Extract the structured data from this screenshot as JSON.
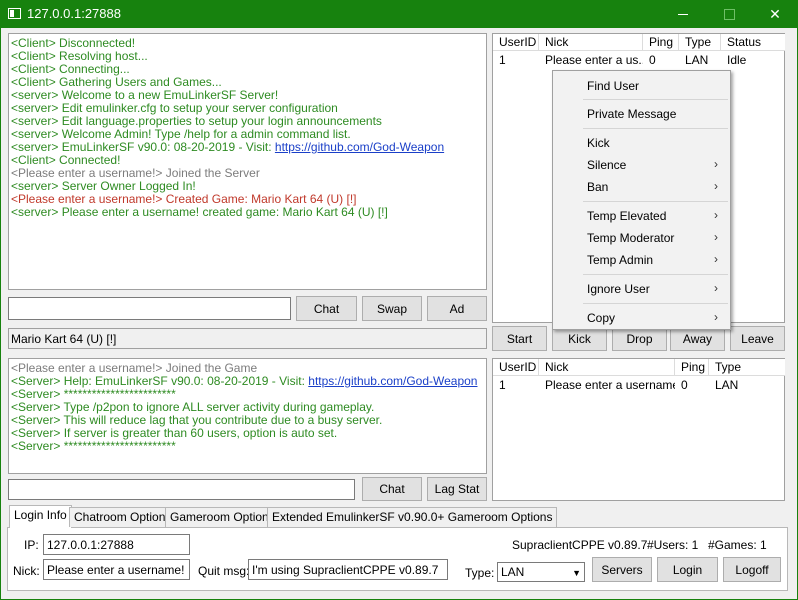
{
  "window": {
    "title": "127.0.0.1:27888",
    "close_glyph": "✕"
  },
  "server_chat": {
    "lines": [
      {
        "text": "<Client> Disconnected!",
        "cls": "g"
      },
      {
        "text": "<Client> Resolving host...",
        "cls": "g"
      },
      {
        "text": "<Client> Connecting...",
        "cls": "g"
      },
      {
        "text": "<Client> Gathering Users and Games...",
        "cls": "g"
      },
      {
        "text": "<server> Welcome to a new EmuLinkerSF Server!",
        "cls": "g"
      },
      {
        "text": "<server> Edit emulinker.cfg to setup your server configuration",
        "cls": "g"
      },
      {
        "text": "<server> Edit language.properties to setup your login announcements",
        "cls": "g"
      },
      {
        "text": "<server> Welcome Admin! Type /help for a admin command list.",
        "cls": "g"
      },
      {
        "text": "<server> EmuLinkerSF v90.0: 08-20-2019 - Visit: ",
        "cls": "g",
        "link": "https://github.com/God-Weapon"
      },
      {
        "text": "<Client> Connected!",
        "cls": "g"
      },
      {
        "text": "<Please enter a username!> Joined the Server",
        "cls": "gray"
      },
      {
        "text": "<server> Server Owner Logged In!",
        "cls": "g"
      },
      {
        "text": "<Please enter a username!> Created Game: Mario Kart 64 (U) [!]",
        "cls": "red"
      },
      {
        "text": "<server> Please enter a username! created game: Mario Kart 64 (U) [!]",
        "cls": "g"
      }
    ],
    "input_value": "",
    "chat_button": "Chat",
    "swap_button": "Swap",
    "ad_button": "Ad"
  },
  "users_table": {
    "headers": [
      "UserID",
      "Nick",
      "Ping",
      "Type",
      "Status"
    ],
    "rows": [
      [
        "1",
        "Please enter a us...",
        "0",
        "LAN",
        "Idle"
      ]
    ]
  },
  "context_menu": {
    "items": [
      {
        "label": "Find User",
        "submenu": false
      },
      {
        "label": "Private Message",
        "submenu": false
      },
      {
        "label": "Kick",
        "submenu": false
      },
      {
        "label": "Silence",
        "submenu": true
      },
      {
        "label": "Ban",
        "submenu": true
      },
      {
        "label": "Temp Elevated",
        "submenu": true
      },
      {
        "label": "Temp Moderator",
        "submenu": true
      },
      {
        "label": "Temp Admin",
        "submenu": true
      },
      {
        "label": "Ignore User",
        "submenu": true
      },
      {
        "label": "Copy",
        "submenu": true
      }
    ],
    "arrow_glyph": "›"
  },
  "game_bar": {
    "game_name": "Mario Kart 64 (U) [!]",
    "start": "Start",
    "kick": "Kick",
    "drop": "Drop",
    "away": "Away",
    "leave": "Leave"
  },
  "game_chat": {
    "lines": [
      {
        "text": "<Please enter a username!> Joined the Game",
        "cls": "gray"
      },
      {
        "text": "<Server> Help: EmuLinkerSF v90.0: 08-20-2019 - Visit: ",
        "cls": "g",
        "link": "https://github.com/God-Weapon"
      },
      {
        "text": "<Server> ************************",
        "cls": "g"
      },
      {
        "text": "<Server> Type /p2pon to ignore ALL server activity during gameplay.",
        "cls": "g"
      },
      {
        "text": "<Server> This will reduce lag that you contribute due to a busy server.",
        "cls": "g"
      },
      {
        "text": "<Server> If server is greater than 60 users, option is auto set.",
        "cls": "g"
      },
      {
        "text": "<Server> ************************",
        "cls": "g"
      }
    ],
    "input_value": "",
    "chat_button": "Chat",
    "lagstat_button": "Lag Stat"
  },
  "game_users_table": {
    "headers": [
      "UserID",
      "Nick",
      "Ping",
      "Type"
    ],
    "rows": [
      [
        "1",
        "Please enter a username!",
        "0",
        "LAN"
      ]
    ]
  },
  "tabs": [
    {
      "label": "Login Info",
      "active": true
    },
    {
      "label": "Chatroom Options",
      "active": false
    },
    {
      "label": "Gameroom Options",
      "active": false
    },
    {
      "label": "Extended EmulinkerSF v0.90.0+ Gameroom Options",
      "active": false
    }
  ],
  "login": {
    "ip_label": "IP:",
    "ip_value": "127.0.0.1:27888",
    "nick_label": "Nick:",
    "nick_value": "Please enter a username!",
    "quit_label": "Quit msg:",
    "quit_value": "I'm using SupraclientCPPE v0.89.7",
    "type_label": "Type:",
    "type_value": "LAN",
    "client_version": "SupraclientCPPE v0.89.7",
    "users_count": "#Users: 1",
    "games_count": "#Games: 1",
    "servers_button": "Servers",
    "login_button": "Login",
    "logoff_button": "Logoff"
  }
}
